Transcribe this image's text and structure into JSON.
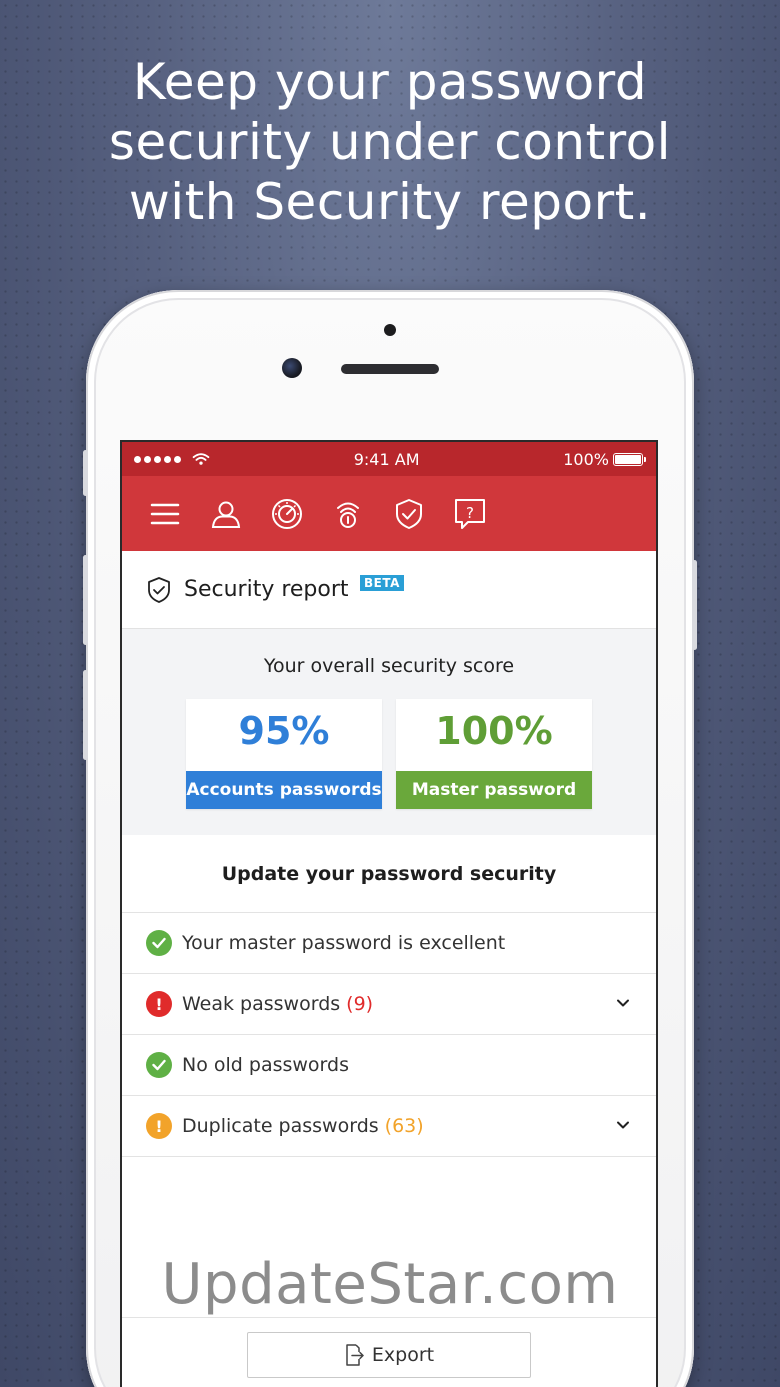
{
  "headline": {
    "line1": "Keep your password",
    "line2": "security under control",
    "line3": "with Security report."
  },
  "status_bar": {
    "time": "9:41 AM",
    "battery": "100%"
  },
  "toolbar": {
    "icons": [
      "menu-icon",
      "user-icon",
      "dashboard-icon",
      "password-generator-icon",
      "shield-check-icon",
      "help-icon"
    ]
  },
  "header": {
    "title": "Security report",
    "badge": "BETA"
  },
  "score": {
    "title": "Your overall security score",
    "cards": [
      {
        "value": "95%",
        "label": "Accounts passwords",
        "color": "#2f7fd8"
      },
      {
        "value": "100%",
        "label": "Master password",
        "color": "#6aa83b"
      }
    ]
  },
  "update": {
    "title": "Update your password security",
    "rows": [
      {
        "text": "Your master password is excellent",
        "count": "",
        "status": "ok"
      },
      {
        "text": "Weak passwords",
        "count": "(9)",
        "status": "error"
      },
      {
        "text": "No old passwords",
        "count": "",
        "status": "ok"
      },
      {
        "text": "Duplicate passwords",
        "count": "(63)",
        "status": "warning"
      }
    ]
  },
  "export": {
    "label": "Export"
  },
  "watermark": "UpdateStar.com",
  "colors": {
    "brand_red": "#d0373b",
    "ok_green": "#5fb045",
    "error_red": "#e02b2b",
    "warning_orange": "#f2a32a",
    "beta_blue": "#2a9fd6"
  }
}
